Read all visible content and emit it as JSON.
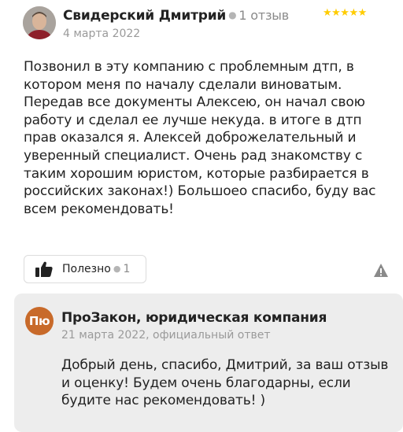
{
  "review": {
    "author_name": "Свидерский Дмитрий",
    "review_count": "1 отзыв",
    "date": "4 марта 2022",
    "rating": 5,
    "stars": "★★★★★",
    "text": "Позвонил в эту компанию с проблемным дтп, в котором меня по началу сделали виноватым. Передав все документы Алексею, он начал свою работу и сделал ее лучше некуда. в итоге в дтп прав оказался я. Алексей доброжелательный и уверенный специалист. Очень рад знакомству с таким хорошим юристом, которые разбирается в российских законах!) Большоео спасибо, буду вас всем рекомендовать!",
    "useful_label": "Полезно",
    "useful_count": "1",
    "star_color": "#ffcc00"
  },
  "reply": {
    "logo_text": "Пю",
    "logo_color": "#c86a2a",
    "org_name": "ПроЗакон, юридическая компания",
    "date_line": "21 марта 2022, официальный ответ",
    "text": "Добрый день, спасибо, Дмитрий, за ваш отзыв и оценку! Будем очень благодарны, если будите нас рекомендовать! )"
  }
}
